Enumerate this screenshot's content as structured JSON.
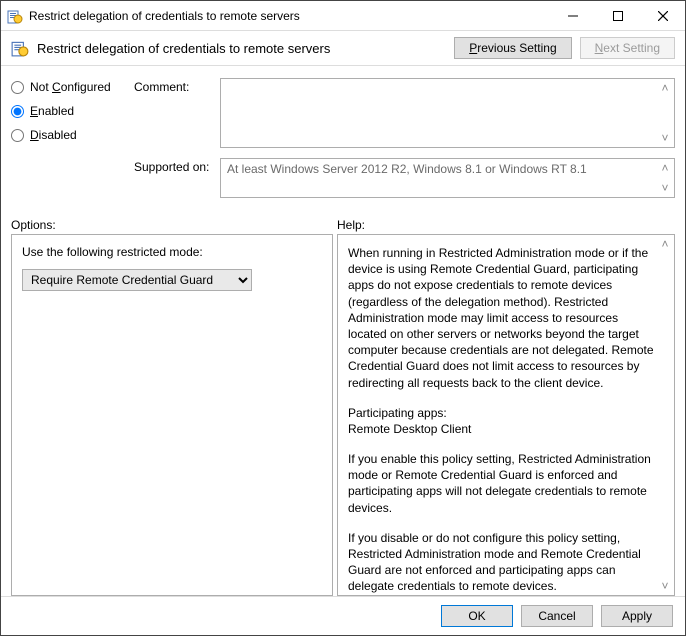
{
  "window": {
    "title": "Restrict delegation of credentials to remote servers"
  },
  "header": {
    "title": "Restrict delegation of credentials to remote servers",
    "prev": "Previous Setting",
    "next": "Next Setting"
  },
  "radios": {
    "not_configured": "Not Configured",
    "enabled": "Enabled",
    "disabled": "Disabled",
    "selected": "enabled"
  },
  "fields": {
    "comment_label": "Comment:",
    "comment_value": "",
    "supported_label": "Supported on:",
    "supported_value": "At least Windows Server 2012 R2, Windows 8.1 or Windows RT 8.1"
  },
  "sections": {
    "options_label": "Options:",
    "help_label": "Help:"
  },
  "options": {
    "mode_label": "Use the following restricted mode:",
    "mode_selected": "Require Remote Credential Guard",
    "mode_options": [
      "Require Remote Credential Guard"
    ]
  },
  "help": {
    "p1": "When running in Restricted Administration mode or if the device is using Remote Credential Guard, participating apps do not expose credentials to remote devices (regardless of the delegation method). Restricted Administration mode may limit access to resources located on other servers or networks beyond the target computer because credentials are not delegated. Remote Credential Guard does not limit access to resources by redirecting all requests back to the client device.",
    "p2": "Participating apps:",
    "p3": "Remote Desktop Client",
    "p4": "If you enable this policy setting, Restricted Administration mode or Remote Credential Guard is enforced and participating apps will not delegate credentials to remote devices.",
    "p5": "If you disable or do not configure this policy setting, Restricted Administration mode and Remote Credential Guard are not enforced and participating apps can delegate credentials to remote devices."
  },
  "footer": {
    "ok": "OK",
    "cancel": "Cancel",
    "apply": "Apply"
  }
}
